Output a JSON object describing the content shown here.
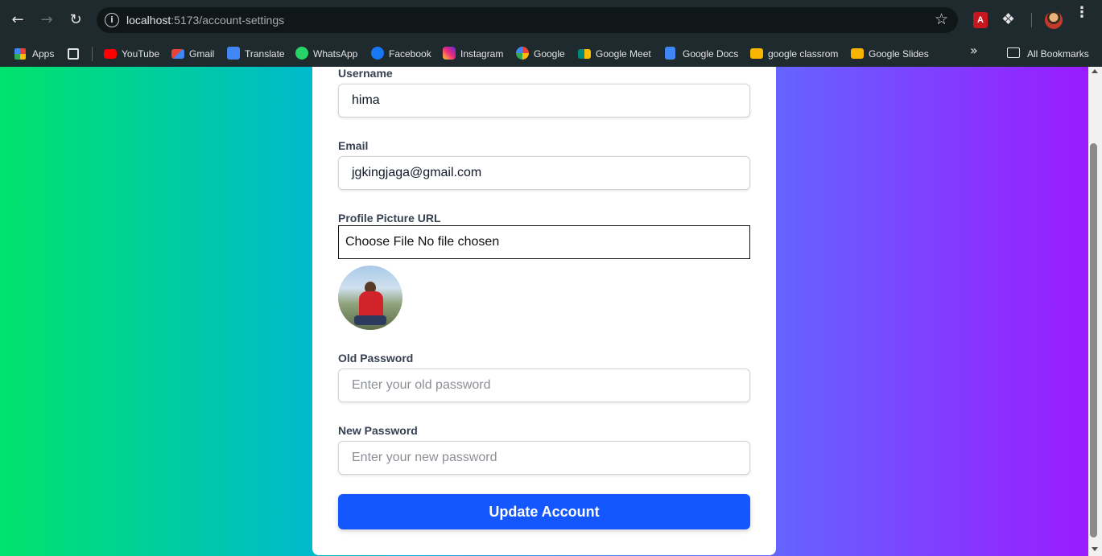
{
  "browser": {
    "url_host": "localhost",
    "url_path": ":5173/account-settings",
    "icons": {
      "back": "arrow-left-icon",
      "forward": "arrow-right-icon",
      "reload": "reload-icon",
      "site_info": "info-icon",
      "bookmark_star": "star-icon",
      "extensions": "puzzle-icon",
      "menu": "kebab-menu-icon"
    },
    "pdf_extension_label": "A"
  },
  "bookmarks": {
    "items": [
      {
        "label": "Apps",
        "icon": "apps-grid-icon",
        "color": "#4285f4"
      },
      {
        "label": "",
        "icon": "grid-icon",
        "color": "#e3e3e3"
      },
      {
        "label": "YouTube",
        "icon": "youtube-icon",
        "color": "#ff0000"
      },
      {
        "label": "Gmail",
        "icon": "gmail-icon",
        "color": "#ea4335"
      },
      {
        "label": "Translate",
        "icon": "translate-icon",
        "color": "#4285f4"
      },
      {
        "label": "WhatsApp",
        "icon": "whatsapp-icon",
        "color": "#25d366"
      },
      {
        "label": "Facebook",
        "icon": "facebook-icon",
        "color": "#1877f2"
      },
      {
        "label": "Instagram",
        "icon": "instagram-icon",
        "color": "#d6249f"
      },
      {
        "label": "Google",
        "icon": "google-icon",
        "color": "#ffffff"
      },
      {
        "label": "Google Meet",
        "icon": "meet-icon",
        "color": "#00897b"
      },
      {
        "label": "Google Docs",
        "icon": "docs-icon",
        "color": "#4285f4"
      },
      {
        "label": "google classrom",
        "icon": "classroom-icon",
        "color": "#f7b500"
      },
      {
        "label": "Google Slides",
        "icon": "slides-icon",
        "color": "#f4b400"
      }
    ],
    "more_label": "»",
    "all_bookmarks_label": "All Bookmarks"
  },
  "form": {
    "username_label": "Username",
    "username_value": "hima",
    "email_label": "Email",
    "email_value": "jgkingjaga@gmail.com",
    "profile_picture_label": "Profile Picture URL",
    "file_input_text": "Choose File No file chosen",
    "old_password_label": "Old Password",
    "old_password_placeholder": "Enter your old password",
    "new_password_label": "New Password",
    "new_password_placeholder": "Enter your new password",
    "submit_label": "Update Account"
  },
  "colors": {
    "primary_button": "#1557ff",
    "gradient_start": "#00e36c",
    "gradient_end": "#9a1bff"
  }
}
